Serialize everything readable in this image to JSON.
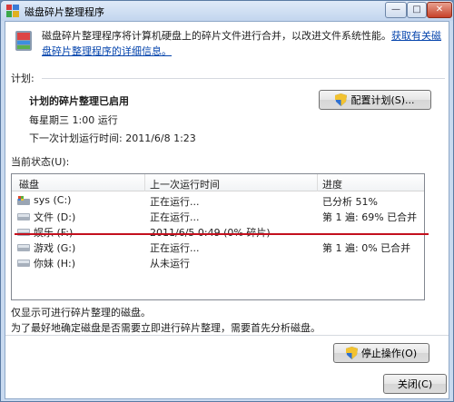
{
  "window": {
    "title": "磁盘碎片整理程序",
    "controls": {
      "minimize": "—",
      "maximize": "□",
      "close": "✕"
    }
  },
  "intro": {
    "text": "磁盘碎片整理程序将计算机硬盘上的碎片文件进行合并，以改进文件系统性能。",
    "link": "获取有关磁盘碎片整理程序的详细信息。"
  },
  "schedule": {
    "section_label": "计划:",
    "status": "计划的碎片整理已启用",
    "frequency": "每星期三  1:00 运行",
    "next_run": "下一次计划运行时间: 2011/6/8 1:23",
    "configure_button": "配置计划(S)..."
  },
  "current_status": {
    "section_label": "当前状态(U):",
    "columns": [
      "磁盘",
      "上一次运行时间",
      "进度"
    ],
    "rows": [
      {
        "disk": "sys (C:)",
        "last_run": "正在运行...",
        "progress": "已分析 51%",
        "icon": "system-drive-icon"
      },
      {
        "disk": "文件 (D:)",
        "last_run": "正在运行...",
        "progress": "第 1 遍: 69% 已合并",
        "icon": "drive-icon"
      },
      {
        "disk": "娱乐 (F:)",
        "last_run": "2011/6/5 0:49 (0% 碎片)",
        "progress": "",
        "icon": "drive-icon"
      },
      {
        "disk": "游戏 (G:)",
        "last_run": "正在运行...",
        "progress": "第 1 遍: 0% 已合并",
        "icon": "drive-icon"
      },
      {
        "disk": "你妹 (H:)",
        "last_run": "从未运行",
        "progress": "",
        "icon": "drive-icon"
      }
    ]
  },
  "notes": {
    "line1": "仅显示可进行碎片整理的磁盘。",
    "line2": "为了最好地确定磁盘是否需要立即进行碎片整理，需要首先分析磁盘。"
  },
  "actions": {
    "stop": "停止操作(O)",
    "close": "关闭(C)"
  },
  "colors": {
    "highlight_line": "#c3101d",
    "link": "#0645ad"
  }
}
